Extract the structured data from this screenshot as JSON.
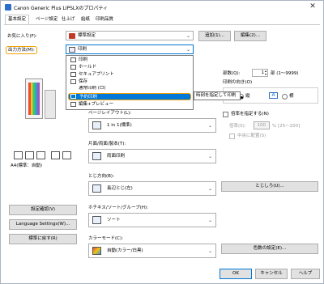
{
  "window": {
    "title": "Canon Generic Plus LIPSLXのプロパティ",
    "close": "✕"
  },
  "tabs": [
    {
      "label": "基本設定"
    },
    {
      "label": "ページ設定"
    },
    {
      "label": "仕上げ"
    },
    {
      "label": "給紙"
    },
    {
      "label": "印刷品質"
    }
  ],
  "favorites": {
    "label": "お気に入り(F):",
    "value": "標準設定",
    "add_button": "追加(1)...",
    "edit_button": "編集(2)..."
  },
  "output_method": {
    "label": "出力方法(M):",
    "value": "印刷"
  },
  "dropdown": {
    "items": [
      {
        "label": "印刷"
      },
      {
        "label": "ホールド"
      },
      {
        "label": "セキュアプリント"
      },
      {
        "label": "保存"
      },
      {
        "label": "通常印刷 (ロ)"
      },
      {
        "label": "予約印刷"
      },
      {
        "label": "編集+プレビュー"
      }
    ],
    "selected_index": 5,
    "tooltip": "時刻を指定して印刷"
  },
  "copies": {
    "label": "部数(Q):",
    "value": "1",
    "unit": "部 (1〜9999)"
  },
  "orientation": {
    "label": "印刷の向き(O)",
    "portrait": "縦",
    "landscape": "横"
  },
  "page_layout": {
    "label": "ページレイアウト(L):",
    "value": "1 in 1(標準)"
  },
  "scaling": {
    "label": "倍率を指定する(N)",
    "zoom_label": "倍率(0):",
    "zoom_value": "100",
    "zoom_unit": "% [25〜200]",
    "center": "中央に配置(S)"
  },
  "duplex": {
    "label": "片面/両面/製本(T):",
    "value": "両面印刷"
  },
  "binding": {
    "label": "とじ方向(B):",
    "value": "長辺とじ(左)",
    "button": "とじしろ(U)..."
  },
  "staple": {
    "label": "ホチキス/ソート/グループ(H):",
    "value": "ソート"
  },
  "color": {
    "label": "カラーモード(C):",
    "value": "自動(カラー/白黒)",
    "button": "色数の設定(E)..."
  },
  "preview": {
    "paper_text": "A4(標準：自動)"
  },
  "left_buttons": {
    "confirm": "設定確認(V)",
    "language": "Language Settings(W)...",
    "restore": "標準に戻す(R)"
  },
  "footer": {
    "ok": "OK",
    "cancel": "キャンセル",
    "help": "ヘルプ"
  },
  "colors": {
    "accent": "#0078d7",
    "highlight": "#f0a000",
    "button": "#e1e1e1"
  }
}
